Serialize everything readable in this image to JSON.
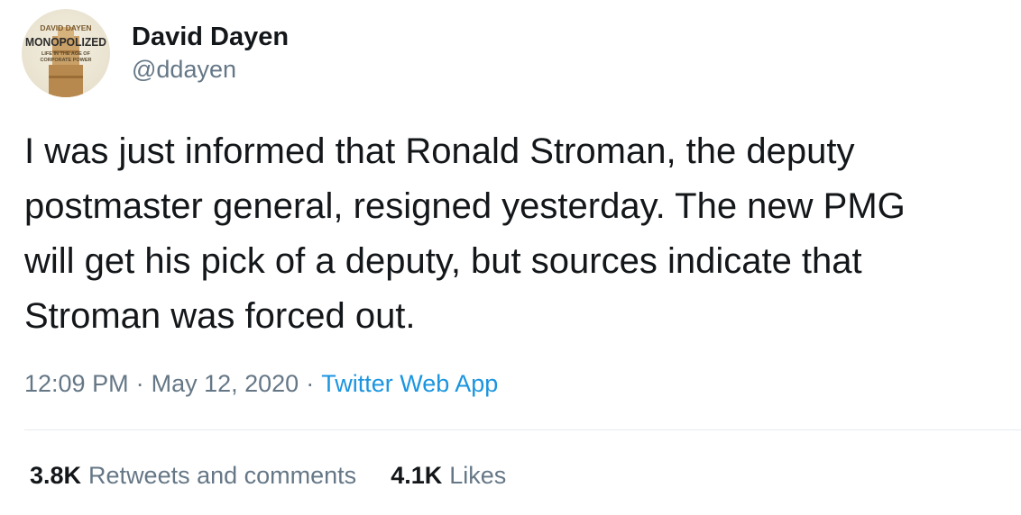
{
  "author": {
    "display_name": "David Dayen",
    "handle": "@ddayen",
    "avatar": {
      "icon": "book-cover-avatar-icon",
      "cover_author": "DAVID DAYEN",
      "cover_title": "MONOPOLIZED",
      "cover_subtitle_1": "LIFE IN THE AGE OF",
      "cover_subtitle_2": "CORPORATE POWER"
    }
  },
  "tweet": {
    "lines": [
      "I was just informed that Ronald Stroman, the deputy",
      "postmaster general, resigned yesterday. The new PMG",
      "will get his pick of a deputy, but sources indicate that",
      "Stroman was forced out."
    ]
  },
  "meta": {
    "time": "12:09 PM",
    "separator": "·",
    "date": "May 12, 2020",
    "source": "Twitter Web App"
  },
  "stats": {
    "retweets_count": "3.8K",
    "retweets_label": "Retweets and comments",
    "likes_count": "4.1K",
    "likes_label": "Likes"
  },
  "colors": {
    "text": "#14171a",
    "secondary": "#657786",
    "link": "#1b95e0",
    "divider": "#e6ecf0"
  }
}
